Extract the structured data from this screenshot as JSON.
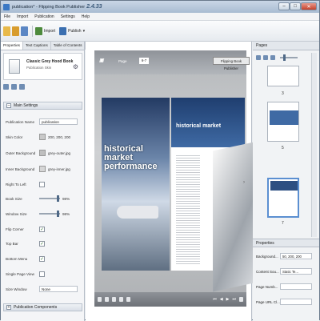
{
  "window": {
    "title": "publication* - Flipping Book Publisher",
    "version": "2.4.33"
  },
  "menu": [
    "File",
    "Import",
    "Publication",
    "Settings",
    "Help"
  ],
  "toolbar": {
    "import_label": "Import",
    "publish_label": "Publish"
  },
  "left_panel": {
    "tabs": [
      "Properties",
      "Text Captions",
      "Table of Contents"
    ],
    "template": {
      "name": "Classic Grey Hood Book",
      "sub": "Publication Skin"
    },
    "main_settings_title": "Main Settings",
    "publication_name_label": "Publication Name",
    "publication_name": "publication",
    "skin_color_label": "Skin Color",
    "skin_color": "200, 200, 200",
    "outer_background_label": "Outer Background",
    "outer_background": "grey-outer.jpg",
    "inner_background_label": "Inner Background",
    "inner_background": "grey-inner.jpg",
    "right_to_left_label": "Right To Left",
    "book_size_label": "Book Size",
    "book_size": "98%",
    "window_size_label": "Window Size",
    "window_size": "98%",
    "flip_corner_label": "Flip Corner",
    "top_bar_label": "Top Bar",
    "bottom_menu_label": "Bottom Menu",
    "single_page_view_label": "Single Page View",
    "size_window_label": "Size Window",
    "size_window": "None",
    "publication_components_title": "Publication Components"
  },
  "book": {
    "page_label": "Page",
    "page_value": "6-7",
    "top_button": "Flipping Book Publisher",
    "headline": "historical market performance",
    "right_headline": "historical market"
  },
  "right_panel": {
    "pages_title": "Pages",
    "thumb_numbers": [
      "3",
      "5",
      "7"
    ],
    "props_title": "Properties",
    "background_color_label": "Background...",
    "background_color": "50, 200, 200",
    "content_source_label": "Content Sou...",
    "content_source": "Static Te...",
    "page_number_label": "Page Numb...",
    "page_url_label": "Page URL Cl..."
  }
}
